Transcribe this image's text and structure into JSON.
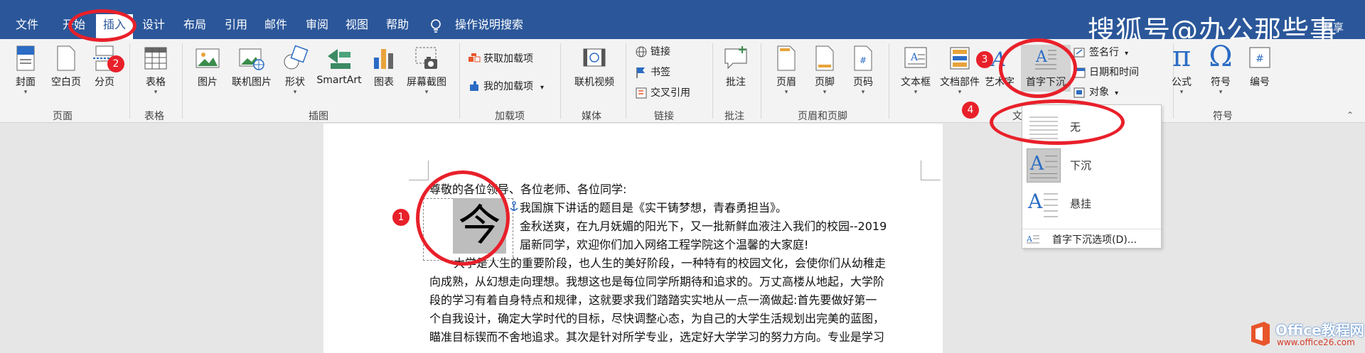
{
  "menu": {
    "tabs": [
      "文件",
      "开始",
      "插入",
      "设计",
      "布局",
      "引用",
      "邮件",
      "审阅",
      "视图",
      "帮助"
    ],
    "tell_me": "操作说明搜索",
    "share": "共享"
  },
  "watermark": "搜狐号@办公那些事",
  "ribbon": {
    "pages": {
      "cover": "封面",
      "blank": "空白页",
      "break": "分页",
      "group": "页面"
    },
    "tables": {
      "table": "表格",
      "group": "表格"
    },
    "illustrations": {
      "pictures": "图片",
      "online_pictures": "联机图片",
      "shapes": "形状",
      "smartart": "SmartArt",
      "chart": "图表",
      "screenshot": "屏幕截图",
      "group": "插图"
    },
    "addins": {
      "get": "获取加载项",
      "my": "我的加载项",
      "group": "加载项"
    },
    "media": {
      "video": "联机视频",
      "group": "媒体"
    },
    "links": {
      "link": "链接",
      "bookmark": "书签",
      "crossref": "交叉引用",
      "group": "链接"
    },
    "comments": {
      "comment": "批注",
      "group": "批注"
    },
    "header_footer": {
      "header": "页眉",
      "footer": "页脚",
      "page_number": "页码",
      "group": "页眉和页脚"
    },
    "text": {
      "textbox": "文本框",
      "quickparts": "文档部件",
      "wordart": "艺术字",
      "dropcap": "首字下沉",
      "signature": "签名行",
      "datetime": "日期和时间",
      "object": "对象",
      "group": "文"
    },
    "symbols": {
      "equation": "公式",
      "symbol": "符号",
      "numbering": "编号",
      "group": "符号"
    }
  },
  "dropcap_menu": {
    "options": [
      "无",
      "下沉",
      "悬挂"
    ],
    "more": "首字下沉选项(D)..."
  },
  "document": {
    "dropcap_char": "今",
    "lines": [
      "尊敬的各位领导、各位老师、各位同学:",
      "我国旗下讲话的题目是《实干铸梦想，青春勇担当》。",
      "金秋送爽，在九月妩媚的阳光下，又一批新鲜血液注入我们的校园--2019",
      "届新同学，欢迎你们加入网络工程学院这个温馨的大家庭!",
      "大学是人生的重要阶段，也人生的美好阶段，一种特有的校园文化，会使你们从幼稚走",
      "向成熟，从幻想走向理想。我想这也是每位同学所期待和追求的。万丈高楼从地起，大学阶",
      "段的学习有着自身特点和规律，这就要求我们踏踏实实地从一点一滴做起:首先要做好第一",
      "个自我设计，确定大学时代的目标，尽快调整心态，为自己的大学生活规划出完美的蓝图，",
      "瞄准目标锲而不舍地追求。其次是针对所学专业，选定好大学学习的努力方向。专业是学习"
    ]
  },
  "annotations": [
    "1",
    "2",
    "3",
    "4"
  ],
  "logo": {
    "name": "Office教程网",
    "url": "www.office26.com"
  },
  "colors": {
    "accent": "#2b579a",
    "annotation": "#e8202a"
  }
}
